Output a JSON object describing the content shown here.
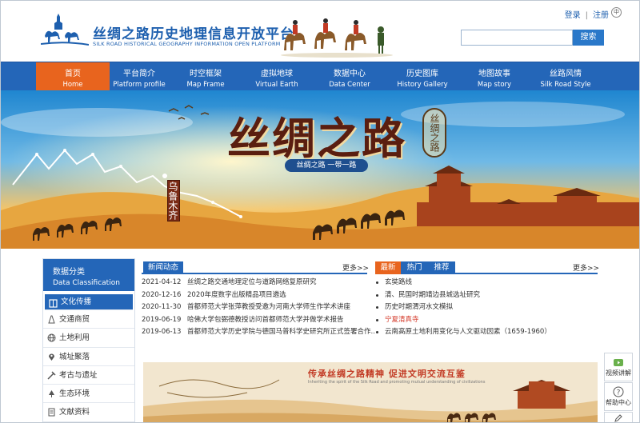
{
  "header": {
    "title": "丝绸之路历史地理信息开放平台",
    "subtitle": "SILK ROAD HISTORICAL GEOGRAPHY INFORMATION OPEN PLATFORM",
    "login": "登录",
    "separator": "|",
    "register": "注册",
    "lang": "中",
    "search_placeholder": "",
    "search_button": "搜索"
  },
  "nav": [
    {
      "zh": "首页",
      "en": "Home",
      "active": true
    },
    {
      "zh": "平台简介",
      "en": "Platform profile"
    },
    {
      "zh": "时空框架",
      "en": "Map Frame"
    },
    {
      "zh": "虚拟地球",
      "en": "Virtual Earth"
    },
    {
      "zh": "数据中心",
      "en": "Data Center"
    },
    {
      "zh": "历史图库",
      "en": "History Gallery"
    },
    {
      "zh": "地图故事",
      "en": "Map story"
    },
    {
      "zh": "丝路风情",
      "en": "Silk Road Style"
    }
  ],
  "banner": {
    "title": "丝绸之路",
    "seal": "丝绸之路",
    "slogan": "丝绸之路 一带一路",
    "city": "乌鲁木齐",
    "slides": 3,
    "active_slide": 1
  },
  "sidebar": {
    "title_zh": "数据分类",
    "title_en": "Data Classification",
    "items": [
      {
        "label": "文化传播",
        "icon": "book-icon",
        "active": true
      },
      {
        "label": "交通商贸",
        "icon": "road-icon"
      },
      {
        "label": "土地利用",
        "icon": "globe-icon"
      },
      {
        "label": "城址聚落",
        "icon": "location-icon"
      },
      {
        "label": "考古与遗址",
        "icon": "archaeology-icon"
      },
      {
        "label": "生态环境",
        "icon": "tree-icon"
      },
      {
        "label": "文献资料",
        "icon": "document-icon"
      }
    ]
  },
  "news": {
    "tab": "新闻动态",
    "more": "更多>>",
    "items": [
      {
        "date": "2021-04-12",
        "title": "丝绸之路交通地理定位与道路网络复原研究"
      },
      {
        "date": "2020-12-16",
        "title": "2020年度数字出版精品项目遴选"
      },
      {
        "date": "2020-11-30",
        "title": "首都师范大学张萍教授受邀为河南大学师生作学术讲座"
      },
      {
        "date": "2019-06-19",
        "title": "哈佛大学包弼德教授访问首都师范大学并做学术报告"
      },
      {
        "date": "2019-06-13",
        "title": "首都师范大学历史学院与德国马普科学史研究所正式签署合作..."
      }
    ]
  },
  "latest": {
    "tabs": [
      "最新",
      "热门",
      "推荐"
    ],
    "more": "更多>>",
    "items": [
      {
        "title": "玄奘路线"
      },
      {
        "title": "清、民国时期靖边县城选址研究"
      },
      {
        "title": "历史时期渭河水文模拟"
      },
      {
        "title": "宁夏清真寺",
        "highlight": true
      },
      {
        "title": "云南高原土地利用变化与人文驱动因素（1659-1960）"
      }
    ],
    "highlight_color": "#d43a2a"
  },
  "lower_banner": {
    "title": "传承丝绸之路精神  促进文明交流互鉴",
    "subtitle": "Inheriting the spirit of the Silk Road and promoting mutual understanding of civilizations"
  },
  "float": {
    "video": "视频讲解",
    "help": "帮助中心"
  },
  "colors": {
    "nav": "#2466b8",
    "accent": "#e8641e",
    "brand": "#1d5fae"
  }
}
